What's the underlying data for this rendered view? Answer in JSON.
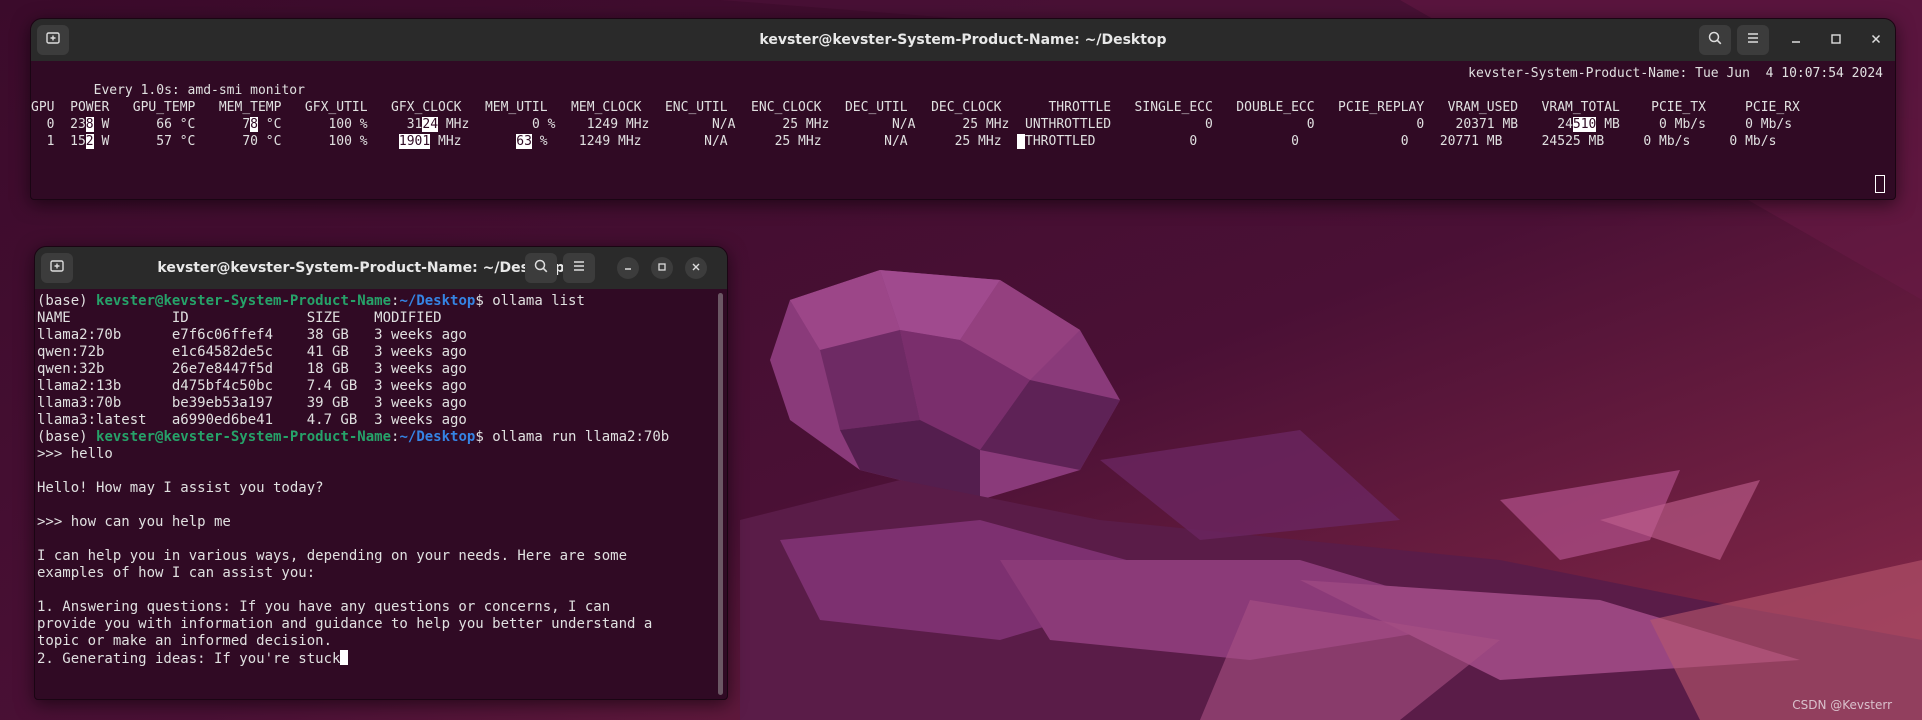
{
  "top_window": {
    "title": "kevster@kevster-System-Product-Name: ~/Desktop",
    "header_left": "Every 1.0s: amd-smi monitor",
    "header_right": "kevster-System-Product-Name: Tue Jun  4 10:07:54 2024",
    "table_header": "GPU  POWER   GPU_TEMP   MEM_TEMP   GFX_UTIL   GFX_CLOCK   MEM_UTIL   MEM_CLOCK   ENC_UTIL   ENC_CLOCK   DEC_UTIL   DEC_CLOCK      THROTTLE   SINGLE_ECC   DOUBLE_ECC   PCIE_REPLAY   VRAM_USED   VRAM_TOTAL    PCIE_TX     PCIE_RX",
    "row0": {
      "a": "  0  23",
      "b": "8",
      "c": " W      66 °C      7",
      "d": "8",
      "e": " °C      100 %     31",
      "f": "24",
      "g": " MHz        0 %    1249 MHz        N/A      25 MHz        N/A      25 MHz  UNTHROTTLED            0            0             0    20371 MB     24",
      "h": "510",
      "i": " MB     0 Mb/s     0 Mb/s"
    },
    "row1": {
      "a": "  1  15",
      "b": "2",
      "c": " W      57 °C      70 °C      100 %    ",
      "d": "1901",
      "e": " MHz       ",
      "f": "63",
      "g": " %    1249 MHz        N/A      25 MHz        N/A      25 MHz  ",
      "h": " ",
      "i": "THROTTLED            0            0             0    20771 MB     24525 MB     0 Mb/s     0 Mb/s"
    }
  },
  "bottom_window": {
    "title": "kevster@kevster-System-Product-Name: ~/Desktop",
    "prompt_env": "(base) ",
    "prompt_user": "kevster@kevster-System-Product-Name",
    "prompt_colon": ":",
    "prompt_path": "~/Desktop",
    "prompt_dollar": "$ ",
    "cmd1": "ollama list",
    "list_header": "NAME            ID              SIZE    MODIFIED",
    "models": [
      "llama2:70b      e7f6c06ffef4    38 GB   3 weeks ago",
      "qwen:72b        e1c64582de5c    41 GB   3 weeks ago",
      "qwen:32b        26e7e8447f5d    18 GB   3 weeks ago",
      "llama2:13b      d475bf4c50bc    7.4 GB  3 weeks ago",
      "llama3:70b      be39eb53a197    39 GB   3 weeks ago",
      "llama3:latest   a6990ed6be41    4.7 GB  3 weeks ago"
    ],
    "cmd2": "ollama run llama2:70b",
    "chat": [
      ">>> hello",
      "",
      "Hello! How may I assist you today?",
      "",
      ">>> how can you help me",
      "",
      "I can help you in various ways, depending on your needs. Here are some",
      "examples of how I can assist you:",
      "",
      "1. Answering questions: If you have any questions or concerns, I can",
      "provide you with information and guidance to help you better understand a",
      "topic or make an informed decision.",
      "2. Generating ideas: If you're stuck"
    ]
  },
  "watermark": "CSDN @Kevsterr",
  "colors": {
    "terminal_bg": "#300a24",
    "titlebar": "#2a2a2a",
    "prompt_user": "#26a269",
    "prompt_path": "#3584e4"
  },
  "icons": [
    "new-tab-icon",
    "search-icon",
    "menu-icon",
    "minimize-icon",
    "maximize-icon",
    "close-icon"
  ]
}
